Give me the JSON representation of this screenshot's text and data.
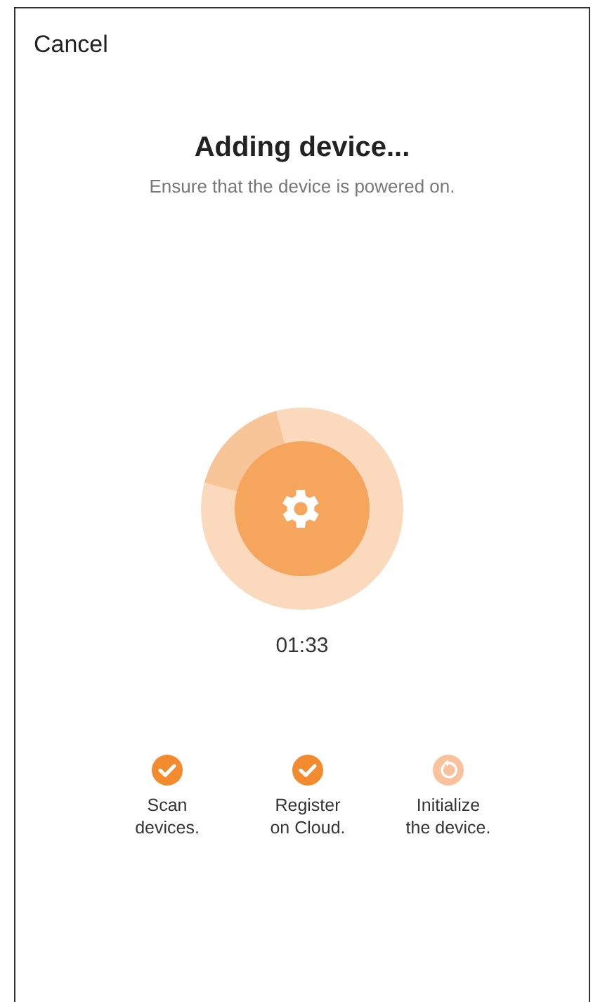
{
  "header": {
    "cancel": "Cancel"
  },
  "title": "Adding device...",
  "subtitle": "Ensure that the device is powered on.",
  "timer": "01:33",
  "steps": [
    {
      "label": "Scan\ndevices.",
      "done": true
    },
    {
      "label": "Register\non Cloud.",
      "done": true
    },
    {
      "label": "Initialize\nthe device.",
      "done": false
    }
  ]
}
